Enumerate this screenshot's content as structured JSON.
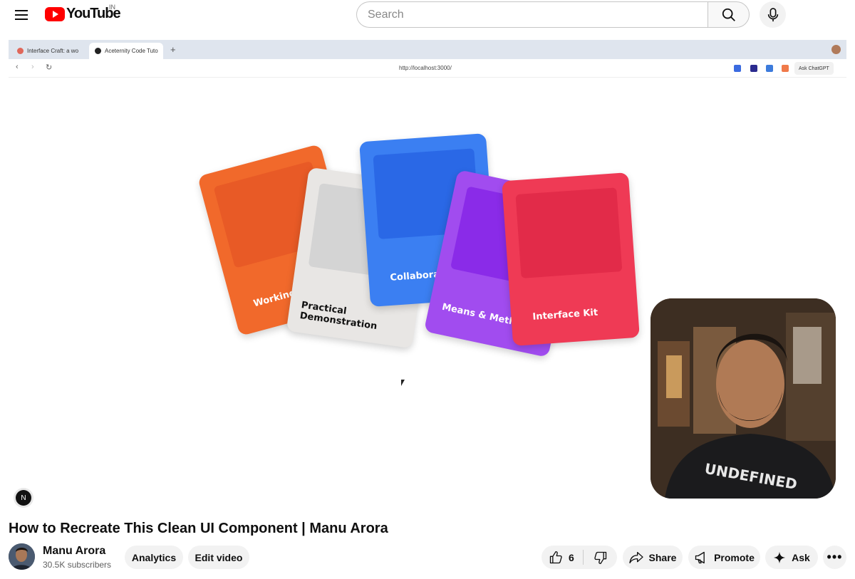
{
  "header": {
    "logo_text": "YouTube",
    "country_code": "IN",
    "search_placeholder": "Search"
  },
  "browser": {
    "tabs": [
      {
        "label": "Interface Craft: a wo",
        "active": false
      },
      {
        "label": "Aceternity Code Tuto",
        "active": true
      }
    ],
    "url": "http://localhost:3000/",
    "ask_chatgpt_label": "Ask ChatGPT"
  },
  "cards": [
    {
      "label": "Working",
      "color": "#f1692b",
      "inner": "#e85a26"
    },
    {
      "label": "Practical Demonstration",
      "color": "#e8e6e4",
      "inner": "#d4d4d4"
    },
    {
      "label": "Collaborate",
      "color": "#3b7ff2",
      "inner": "#2a68e6"
    },
    {
      "label": "Means & Methods",
      "color": "#a14cef",
      "inner": "#8a2be8"
    },
    {
      "label": "Interface Kit",
      "color": "#ef3a55",
      "inner": "#e22b49"
    }
  ],
  "nextjs_badge": "N",
  "webcam_shirt_text": "UNDEFINED",
  "video": {
    "title": "How to Recreate This Clean UI Component | Manu Arora"
  },
  "channel": {
    "name": "Manu Arora",
    "subscribers": "30.5K subscribers"
  },
  "actions": {
    "analytics": "Analytics",
    "edit_video": "Edit video",
    "like_count": "6",
    "share": "Share",
    "promote": "Promote",
    "ask": "Ask",
    "more": "•••"
  }
}
